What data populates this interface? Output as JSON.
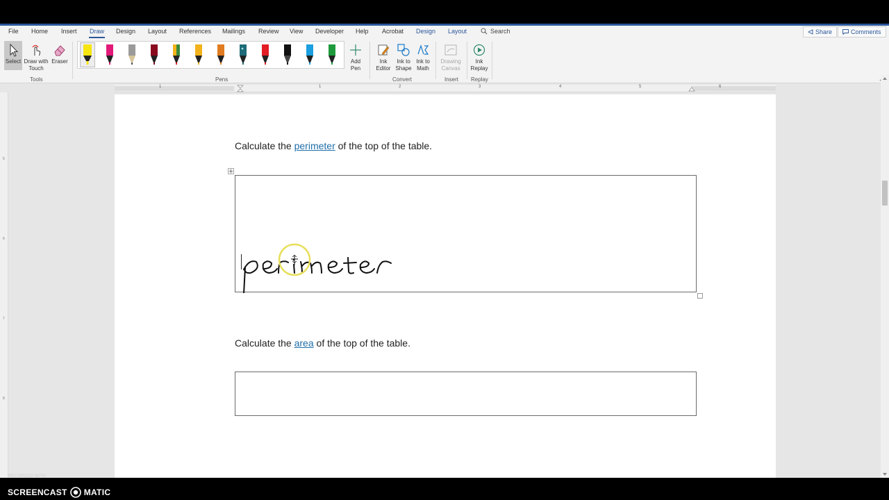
{
  "menu": {
    "tabs": [
      "File",
      "Home",
      "Insert",
      "Draw",
      "Design",
      "Layout",
      "References",
      "Mailings",
      "Review",
      "View",
      "Developer",
      "Help",
      "Acrobat"
    ],
    "active_tab": "Draw",
    "context_tabs": [
      "Design",
      "Layout"
    ],
    "search_label": "Search",
    "share_label": "Share",
    "comments_label": "Comments"
  },
  "ribbon": {
    "tools": {
      "select_label": "Select",
      "draw_touch_label1": "Draw with",
      "draw_touch_label2": "Touch",
      "eraser_label": "Eraser",
      "group_label": "Tools"
    },
    "pens": {
      "group_label": "Pens",
      "colors": [
        "#f7e50f",
        "#e3197a",
        "#9a9a9a",
        "#8b0b1e",
        "#3b8a3a",
        "#f2b21b",
        "#e07b1f",
        "#1e6b77",
        "#e21d24",
        "#111111",
        "#1b9fe0",
        "#1e9a3c"
      ]
    },
    "add_pen_label1": "Add",
    "add_pen_label2": "Pen",
    "convert": {
      "ink_editor_1": "Ink",
      "ink_editor_2": "Editor",
      "ink_shape_1": "Ink to",
      "ink_shape_2": "Shape",
      "ink_math_1": "Ink to",
      "ink_math_2": "Math",
      "group_label": "Convert"
    },
    "insert": {
      "drawing_canvas_1": "Drawing",
      "drawing_canvas_2": "Canvas",
      "group_label": "Insert"
    },
    "replay": {
      "ink_replay_1": "Ink",
      "ink_replay_2": "Replay",
      "group_label": "Replay"
    }
  },
  "ruler_numbers": [
    "1",
    "1",
    "2",
    "3",
    "4",
    "5",
    "6"
  ],
  "document": {
    "q1_before": "Calculate the ",
    "q1_link": "perimeter",
    "q1_after": " of the top of the table.",
    "handwriting": "perimeter",
    "q2_before": "Calculate the ",
    "q2_link": "area",
    "q2_after": " of the top of the table."
  },
  "recorder": {
    "recorded_with": "RECORDED WITH",
    "brand_left": "SCREENCAST",
    "brand_right": "MATIC"
  }
}
